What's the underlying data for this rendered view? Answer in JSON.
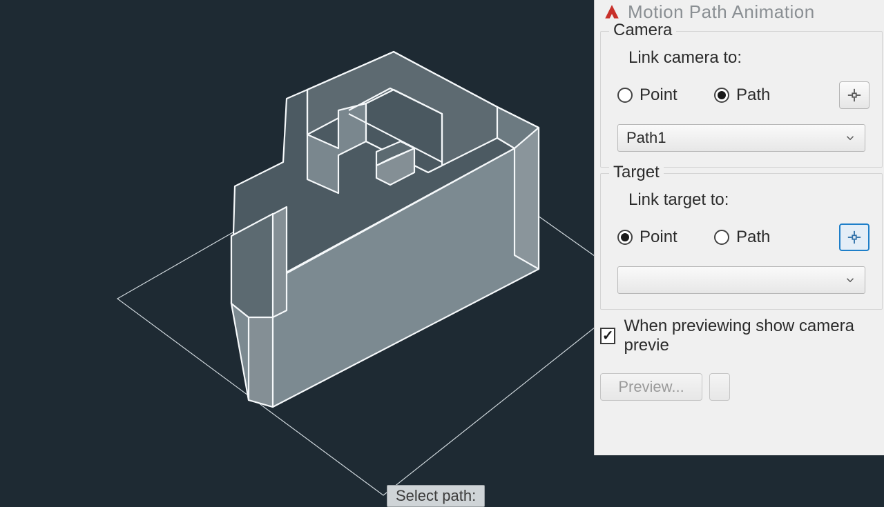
{
  "dialog": {
    "title": "Motion Path Animation",
    "camera": {
      "legend": "Camera",
      "linkLabel": "Link camera to:",
      "pointLabel": "Point",
      "pathLabel": "Path",
      "selected": "path",
      "dropdownValue": "Path1"
    },
    "target": {
      "legend": "Target",
      "linkLabel": "Link target to:",
      "pointLabel": "Point",
      "pathLabel": "Path",
      "selected": "point",
      "dropdownValue": ""
    },
    "previewCheckLabel": "When previewing show camera previe",
    "previewChecked": true,
    "previewButton": "Preview..."
  },
  "viewport": {
    "tooltip": "Select path:"
  }
}
